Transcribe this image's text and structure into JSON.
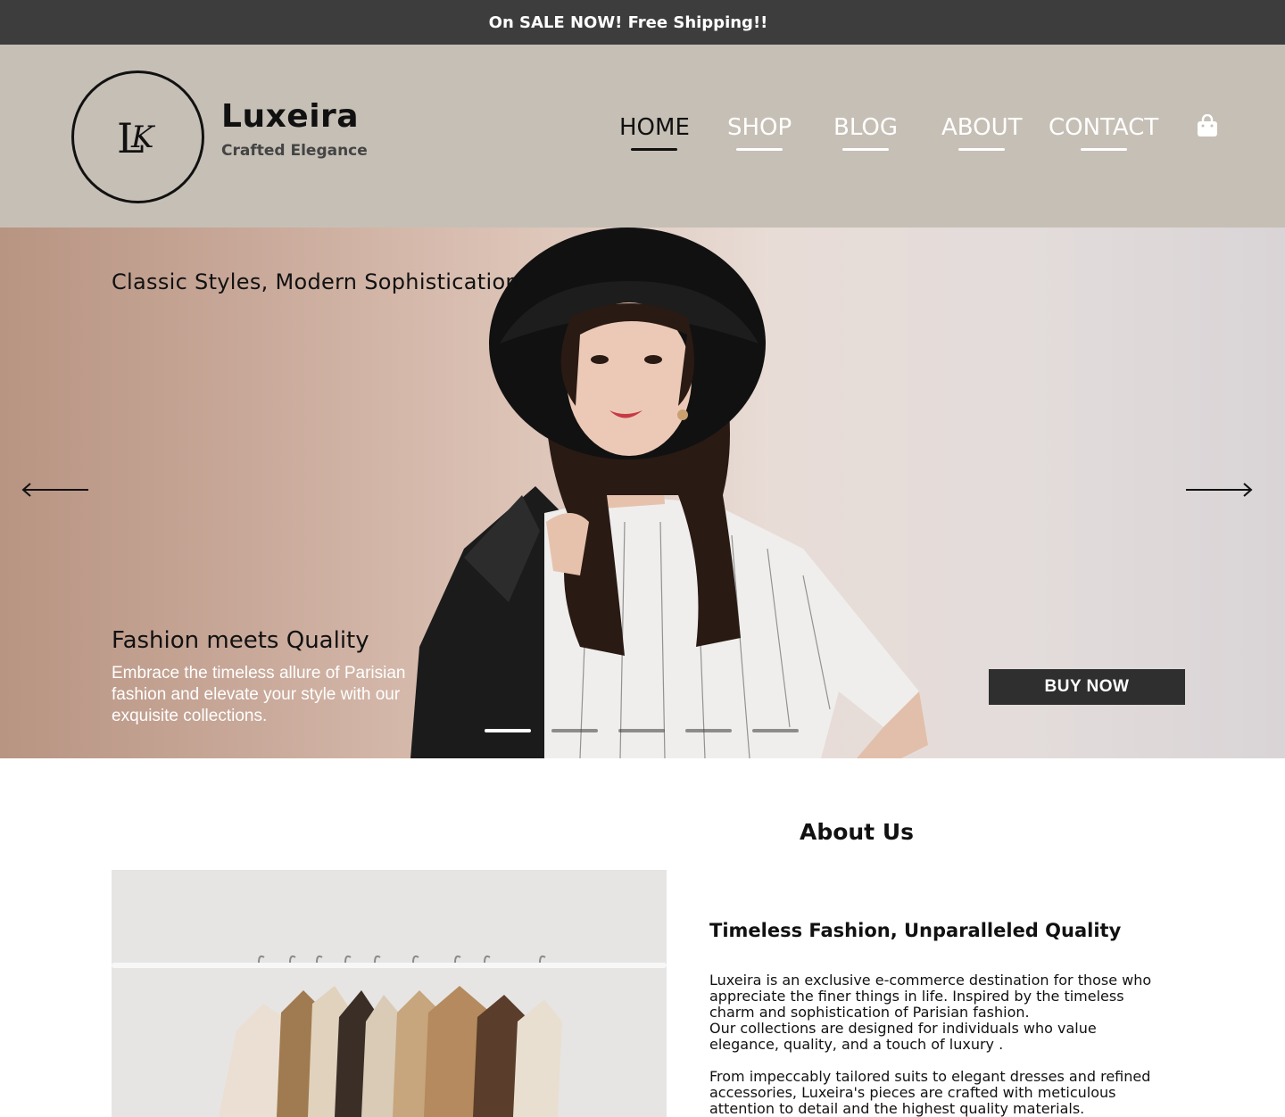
{
  "promo": {
    "text": "On SALE NOW! Free Shipping!!"
  },
  "brand": {
    "name": "Luxeira",
    "tagline": "Crafted Elegance",
    "monogram": "LK"
  },
  "nav": {
    "items": [
      {
        "label": "HOME",
        "active": true
      },
      {
        "label": "SHOP",
        "active": false
      },
      {
        "label": "BLOG",
        "active": false
      },
      {
        "label": "ABOUT",
        "active": false
      },
      {
        "label": "CONTACT",
        "active": false
      }
    ],
    "cart_icon": "shopping-bag-icon"
  },
  "hero": {
    "heading": "Classic Styles, Modern Sophistication",
    "subheading": "Fashion meets Quality",
    "description": "Embrace the timeless allure of Parisian fashion and elevate your style with our exquisite collections.",
    "cta_label": "BUY NOW",
    "slides_count": 5,
    "active_slide": 1,
    "prev_icon": "arrow-left-icon",
    "next_icon": "arrow-right-icon"
  },
  "about": {
    "title": "About Us",
    "heading": "Timeless Fashion, Unparalleled Quality",
    "paragraph1_line1": "Luxeira is an exclusive e-commerce destination for those who appreciate the finer things in life. Inspired by the timeless charm and sophistication of Parisian fashion.",
    "paragraph1_line2": "Our collections are designed for individuals who value elegance, quality, and a touch of luxury .",
    "paragraph2": "From impeccably tailored suits to elegant dresses and refined accessories, Luxeira's pieces are crafted with meticulous attention to detail and the highest quality materials."
  },
  "colors": {
    "promo_bg": "#3d3d3d",
    "header_bg": "#c6bfb5",
    "button_bg": "#2f2f2f",
    "text_dark": "#111111"
  }
}
